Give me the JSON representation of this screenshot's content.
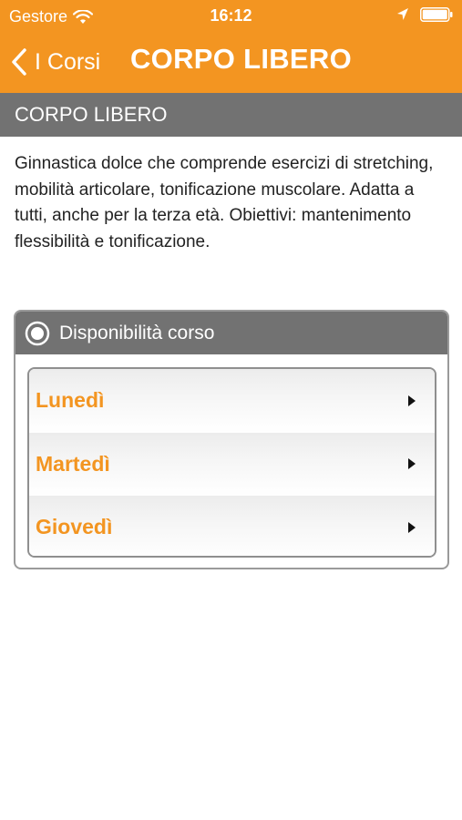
{
  "status_bar": {
    "carrier": "Gestore",
    "time": "16:12",
    "icons": [
      "wifi-icon",
      "location-icon",
      "battery-icon"
    ]
  },
  "nav": {
    "back_label": "I Corsi",
    "title": "CORPO LIBERO"
  },
  "section": {
    "title": "CORPO LIBERO",
    "description": "Ginnastica dolce che comprende esercizi di stretching, mobilità articolare, tonificazione muscolare. Adatta a tutti, anche per la terza età. Obiettivi: mantenimento flessibilità e tonificazione."
  },
  "availability": {
    "title": "Disponibilità corso",
    "days": [
      {
        "label": "Lunedì"
      },
      {
        "label": "Martedì"
      },
      {
        "label": "Giovedì"
      }
    ]
  },
  "colors": {
    "accent": "#f39521",
    "header_gray": "#727272",
    "background": "#ffffff"
  }
}
